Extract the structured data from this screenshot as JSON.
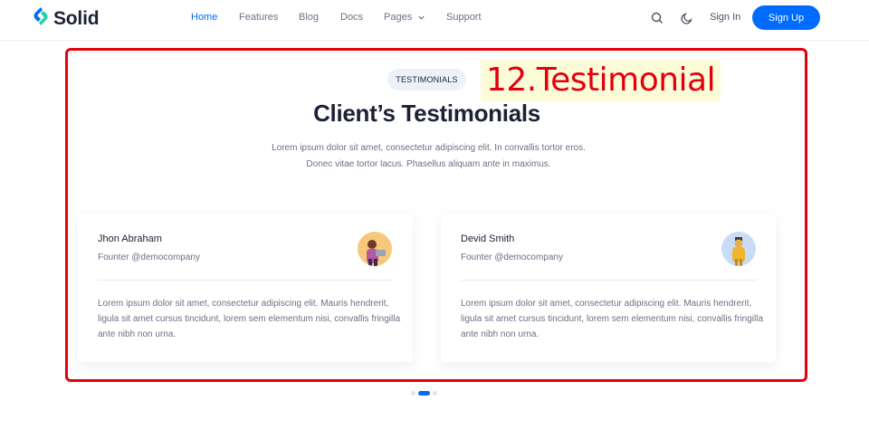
{
  "brand": {
    "name": "Solid",
    "accent": "#006bff"
  },
  "nav": {
    "items": [
      {
        "label": "Home",
        "active": true
      },
      {
        "label": "Features"
      },
      {
        "label": "Blog"
      },
      {
        "label": "Docs"
      },
      {
        "label": "Pages",
        "has_dropdown": true
      },
      {
        "label": "Support"
      }
    ]
  },
  "header_actions": {
    "search_icon": "search-icon",
    "theme_icon": "moon-icon",
    "signin_label": "Sign In",
    "signup_label": "Sign Up"
  },
  "annotation": {
    "label": "12.Testimonial",
    "color": "#e8000b"
  },
  "section": {
    "tag": "TESTIMONIALS",
    "title": "Client’s Testimonials",
    "subtitle_line1": "Lorem ipsum dolor sit amet, consectetur adipiscing elit. In convallis tortor eros.",
    "subtitle_line2": "Donec vitae tortor lacus. Phasellus aliquam ante in maximus."
  },
  "testimonials": [
    {
      "name": "Jhon Abraham",
      "role": "Founter @democompany",
      "body": "Lorem ipsum dolor sit amet, consectetur adipiscing elit. Mauris hendrerit, ligula sit amet cursus tincidunt, lorem sem elementum nisi, convallis fringilla ante nibh non urna."
    },
    {
      "name": "Devid Smith",
      "role": "Founter @democompany",
      "body": "Lorem ipsum dolor sit amet, consectetur adipiscing elit. Mauris hendrerit, ligula sit amet cursus tincidunt, lorem sem elementum nisi, convallis fringilla ante nibh non urna."
    }
  ],
  "carousel": {
    "total": 3,
    "active_index": 1
  }
}
